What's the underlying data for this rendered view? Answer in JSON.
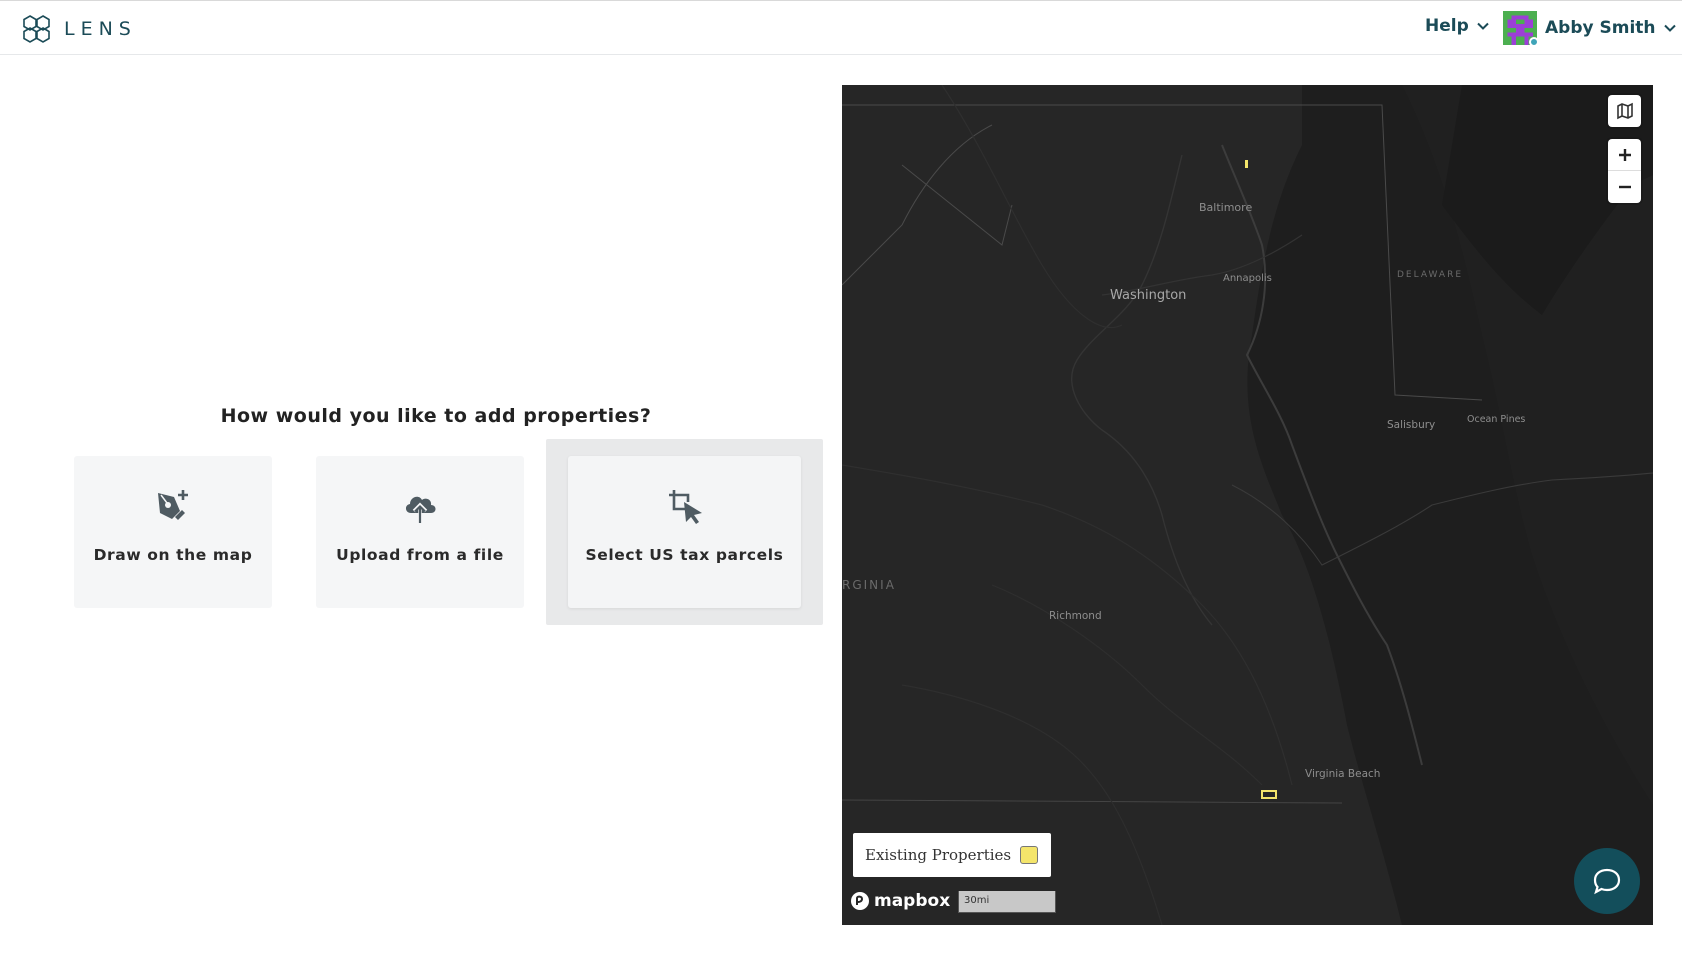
{
  "header": {
    "logo_text": "LENS",
    "help_label": "Help",
    "user_name": "Abby Smith"
  },
  "main": {
    "question": "How would you like to add properties?",
    "options": [
      {
        "label": "Draw on the map",
        "icon": "pen-plus-icon"
      },
      {
        "label": "Upload from a file",
        "icon": "cloud-upload-icon"
      },
      {
        "label": "Select US tax parcels",
        "icon": "crop-cursor-icon"
      }
    ],
    "selected_option": "Select US tax parcels"
  },
  "map": {
    "labels": {
      "baltimore": "Baltimore",
      "washington": "Washington",
      "annapolis": "Annapolis",
      "delaware": "DELAWARE",
      "salisbury": "Salisbury",
      "ocean_pines": "Ocean Pines",
      "virginia": "RGINIA",
      "richmond": "Richmond",
      "virginia_beach": "Virginia Beach"
    },
    "legend_label": "Existing Properties",
    "legend_color": "#f4e56b",
    "attribution": "mapbox",
    "scale_label": "30mi",
    "controls": [
      "map-style-icon",
      "zoom-in-icon",
      "zoom-out-icon"
    ]
  },
  "colors": {
    "brand": "#1b4b57",
    "map_background": "#262626",
    "chat_button": "#134e5b"
  }
}
